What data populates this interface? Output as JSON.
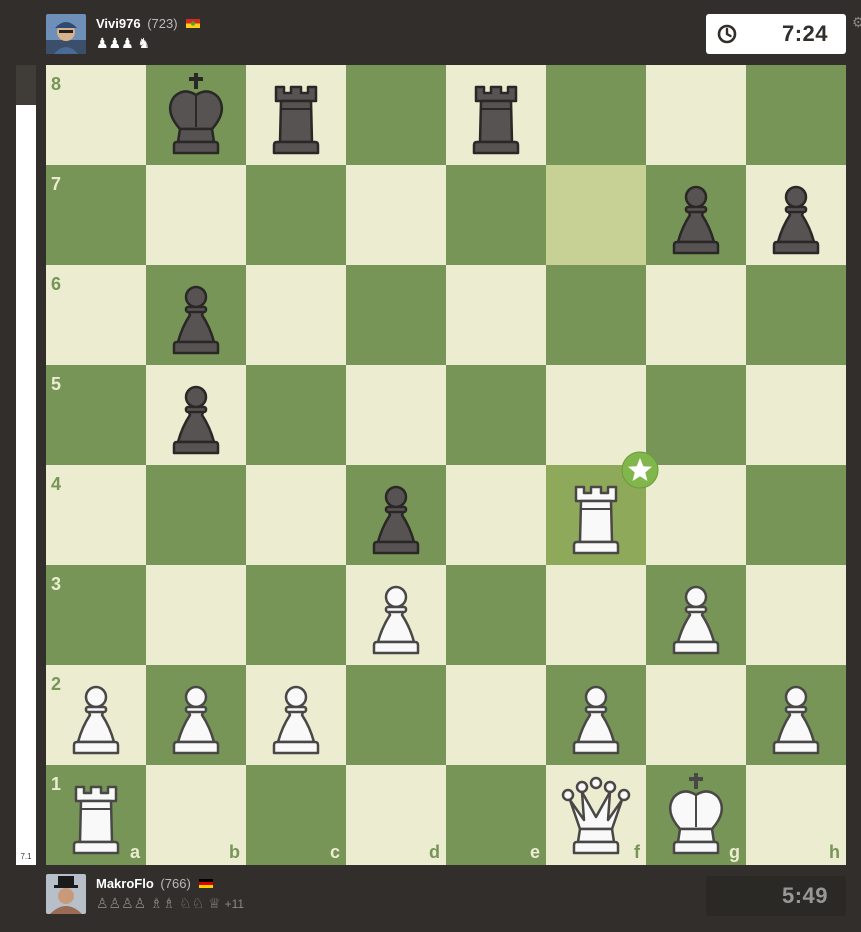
{
  "players": {
    "top": {
      "name": "Vivi976",
      "rating": "(723)",
      "captured": "♟♟♟ ♞",
      "clock": "7:24",
      "clock_state": "active"
    },
    "bottom": {
      "name": "MakroFlo",
      "rating": "(766)",
      "captured": "♙♙♙♙ ♗♗ ♘♘ ♕",
      "advantage": "+11",
      "clock": "5:49",
      "clock_state": "idle"
    }
  },
  "eval": {
    "value": "7.1",
    "white_share": 0.95
  },
  "board": {
    "orientation": "white",
    "files": [
      "a",
      "b",
      "c",
      "d",
      "e",
      "f",
      "g",
      "h"
    ],
    "ranks": [
      "8",
      "7",
      "6",
      "5",
      "4",
      "3",
      "2",
      "1"
    ],
    "colors": {
      "light": "#ebecd0",
      "dark": "#779556",
      "highlight_light": "#c7d195",
      "highlight_dark": "#8fa95a",
      "badge": "#81b64c"
    },
    "highlighted_squares": [
      "f7",
      "f4"
    ],
    "move_badge": {
      "square": "f4",
      "icon": "star-icon"
    },
    "pieces": [
      {
        "square": "b8",
        "color": "black",
        "type": "king"
      },
      {
        "square": "c8",
        "color": "black",
        "type": "rook"
      },
      {
        "square": "e8",
        "color": "black",
        "type": "rook"
      },
      {
        "square": "g7",
        "color": "black",
        "type": "pawn"
      },
      {
        "square": "h7",
        "color": "black",
        "type": "pawn"
      },
      {
        "square": "b6",
        "color": "black",
        "type": "pawn"
      },
      {
        "square": "b5",
        "color": "black",
        "type": "pawn"
      },
      {
        "square": "d4",
        "color": "black",
        "type": "pawn"
      },
      {
        "square": "f4",
        "color": "white",
        "type": "rook"
      },
      {
        "square": "d3",
        "color": "white",
        "type": "pawn"
      },
      {
        "square": "g3",
        "color": "white",
        "type": "pawn"
      },
      {
        "square": "a2",
        "color": "white",
        "type": "pawn"
      },
      {
        "square": "b2",
        "color": "white",
        "type": "pawn"
      },
      {
        "square": "c2",
        "color": "white",
        "type": "pawn"
      },
      {
        "square": "f2",
        "color": "white",
        "type": "pawn"
      },
      {
        "square": "h2",
        "color": "white",
        "type": "pawn"
      },
      {
        "square": "a1",
        "color": "white",
        "type": "rook"
      },
      {
        "square": "f1",
        "color": "white",
        "type": "queen"
      },
      {
        "square": "g1",
        "color": "white",
        "type": "king"
      }
    ]
  }
}
